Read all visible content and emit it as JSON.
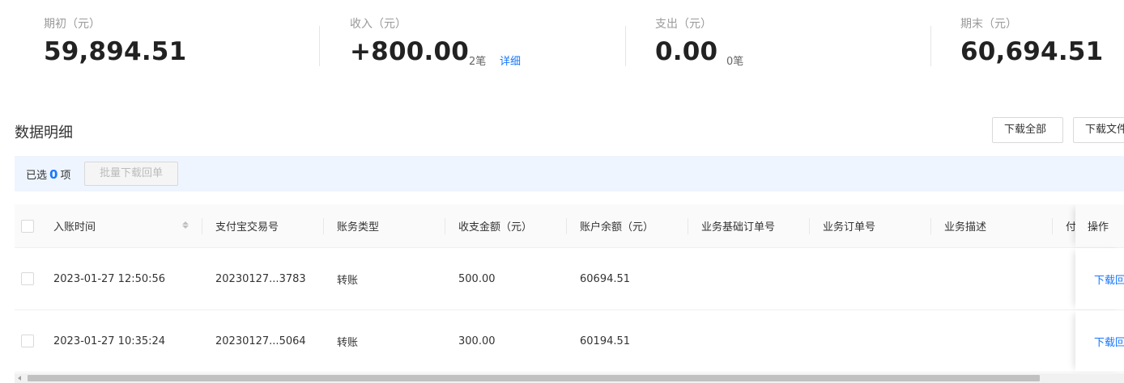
{
  "summary": {
    "opening": {
      "label": "期初（元）",
      "value": "59,894.51"
    },
    "income": {
      "label": "收入（元）",
      "value": "+800.00",
      "count": "2笔",
      "detail": "详细"
    },
    "expense": {
      "label": "支出（元）",
      "value": "0.00",
      "count": "0笔"
    },
    "closing": {
      "label": "期末（元）",
      "value": "60,694.51"
    }
  },
  "section": {
    "title": "数据明细",
    "download_all": "下载全部",
    "download_file": "下载文件"
  },
  "selection": {
    "prefix": "已选",
    "count": "0",
    "suffix": "项",
    "batch_button": "批量下载回单"
  },
  "table": {
    "headers": {
      "time": "入账时间",
      "trade_no": "支付宝交易号",
      "type": "账务类型",
      "amount": "收支金额（元）",
      "balance": "账户余额（元）",
      "base_order": "业务基础订单号",
      "order": "业务订单号",
      "desc": "业务描述",
      "payer": "付",
      "action": "操作"
    },
    "rows": [
      {
        "time": "2023-01-27 12:50:56",
        "trade_no": "20230127...3783",
        "type": "转账",
        "amount": "500.00",
        "balance": "60694.51",
        "action": "下载回单"
      },
      {
        "time": "2023-01-27 10:35:24",
        "trade_no": "20230127...5064",
        "type": "转账",
        "amount": "300.00",
        "balance": "60194.51",
        "action": "下载回单"
      }
    ]
  },
  "colors": {
    "accent": "#1677ff",
    "selection_bar": "#eef5ff"
  }
}
